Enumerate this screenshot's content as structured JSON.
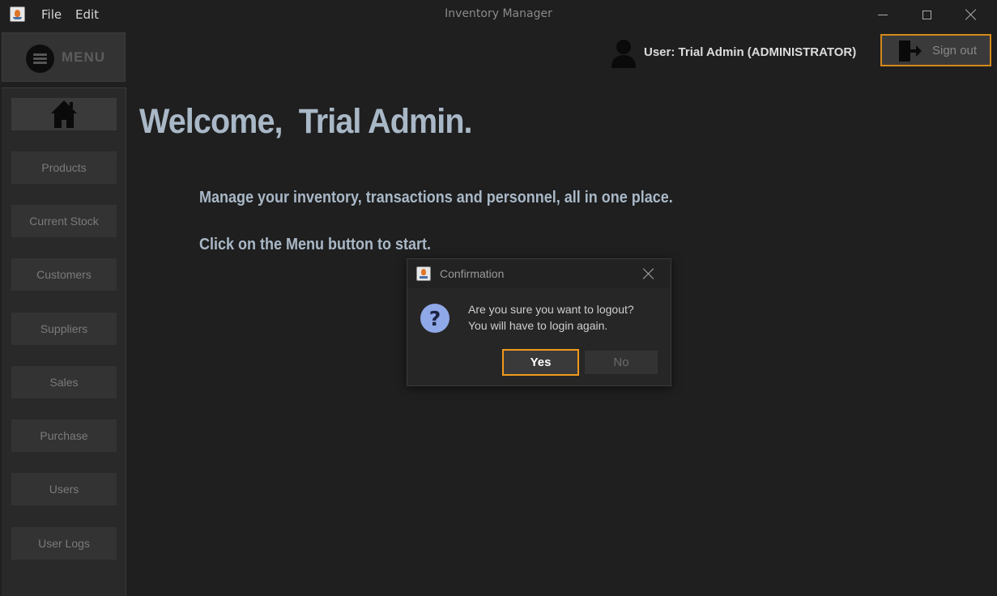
{
  "window": {
    "title": "Inventory Manager",
    "menu": [
      "File",
      "Edit"
    ]
  },
  "sidebar": {
    "menu_label": "MENU",
    "items": [
      {
        "label": "Products"
      },
      {
        "label": "Current Stock"
      },
      {
        "label": "Customers"
      },
      {
        "label": "Suppliers"
      },
      {
        "label": "Sales"
      },
      {
        "label": "Purchase"
      },
      {
        "label": "Users"
      },
      {
        "label": "User Logs"
      }
    ]
  },
  "header": {
    "user_label": "User: Trial Admin (ADMINISTRATOR)",
    "signout_label": "Sign out",
    "accent_color": "#d58a1a"
  },
  "main": {
    "welcome": "Welcome,  Trial Admin.",
    "line1": "Manage your inventory, transactions and personnel, all in one place.",
    "line2": "Click on the Menu button to start."
  },
  "dialog": {
    "title": "Confirmation",
    "message_line1": "Are you sure you want to logout?",
    "message_line2": "You will have to login again.",
    "yes_label": "Yes",
    "no_label": "No",
    "icon": "question-icon"
  }
}
